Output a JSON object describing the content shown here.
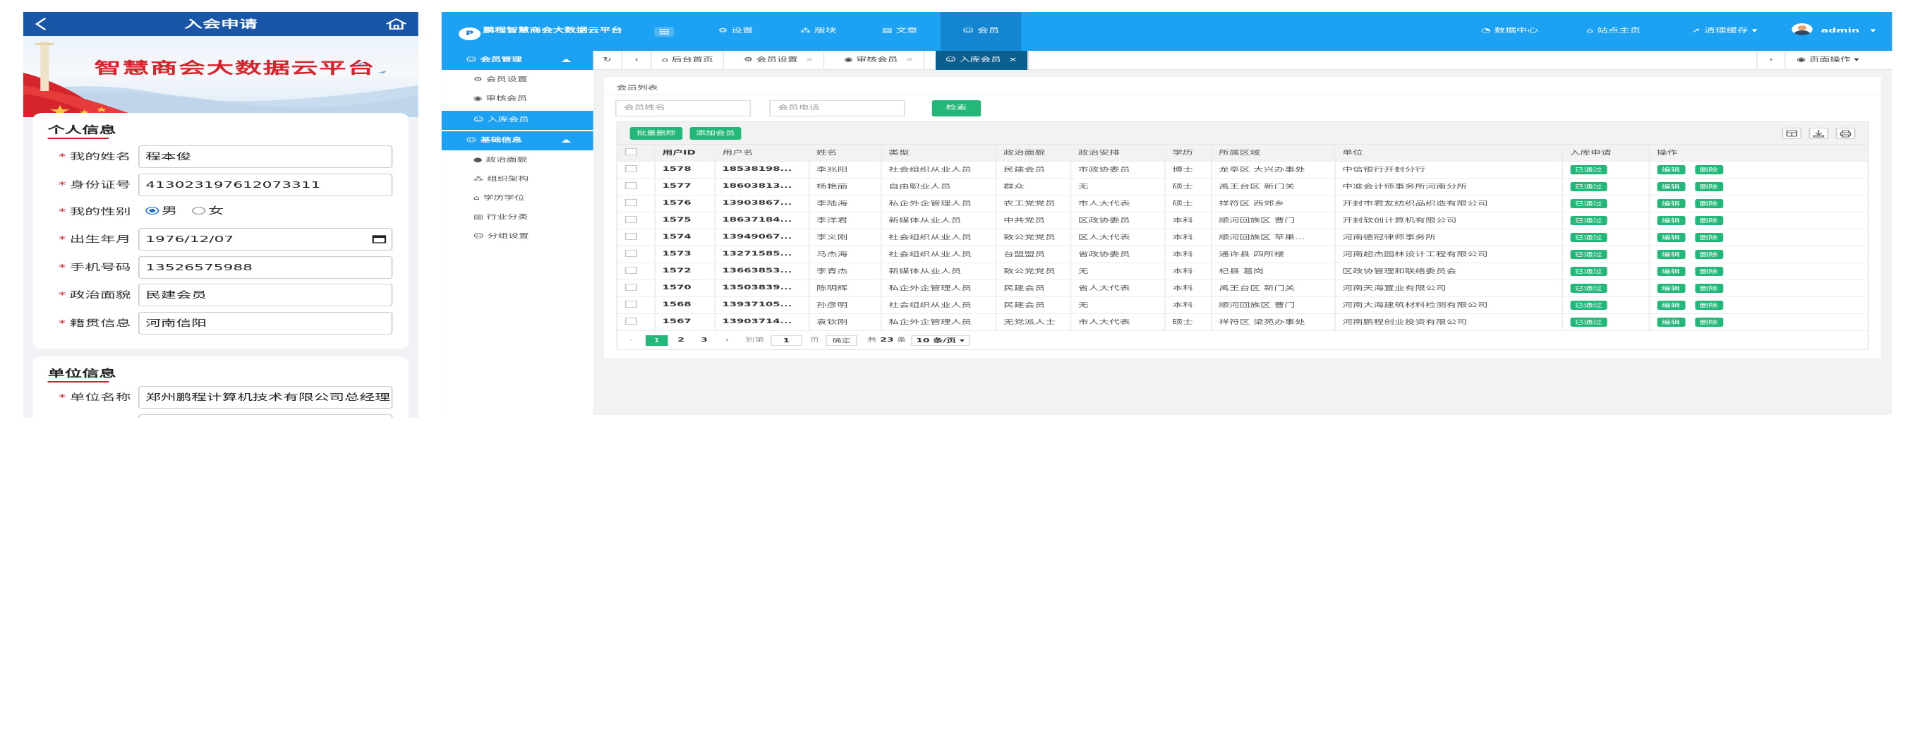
{
  "mobile": {
    "title": "入会申请",
    "banner_text": "智慧商会大数据云平台",
    "personal": {
      "section_title": "个人信息",
      "fields": [
        {
          "label": "我的姓名",
          "value": "程本俊"
        },
        {
          "label": "身份证号",
          "value": "413023197612073311"
        },
        {
          "label": "我的性别",
          "options": [
            "男",
            "女"
          ],
          "selected": "男"
        },
        {
          "label": "出生年月",
          "value": "1976/12/07"
        },
        {
          "label": "手机号码",
          "value": "13526575988"
        },
        {
          "label": "政治面貌",
          "value": "民建会员"
        },
        {
          "label": "籍贯信息",
          "value": "河南信阳"
        }
      ]
    },
    "unit": {
      "section_title": "单位信息",
      "fields": [
        {
          "label": "单位名称",
          "value": "郑州鹏程计算机技术有限公司总经理"
        }
      ]
    }
  },
  "admin": {
    "brand": "鹏程智慧商会大数据云平台",
    "logo_mark": "P",
    "top_nav": [
      {
        "icon": "gear-icon",
        "label": "设置"
      },
      {
        "icon": "blocks-icon",
        "label": "版块"
      },
      {
        "icon": "article-icon",
        "label": "文章"
      },
      {
        "icon": "user-icon",
        "label": "会员"
      }
    ],
    "top_right": [
      {
        "icon": "clock-icon",
        "label": "数据中心"
      },
      {
        "icon": "home-icon",
        "label": "站点主页"
      },
      {
        "icon": "send-icon",
        "label": "清理缓存"
      }
    ],
    "user": "admin",
    "sidebar": {
      "groups": [
        {
          "label": "会员管理",
          "items": [
            "会员设置",
            "审核会员",
            "入库会员"
          ]
        },
        {
          "label": "基础信息",
          "items": [
            "政治面貌",
            "组织架构",
            "学历学位",
            "行业分类",
            "分组设置"
          ]
        }
      ]
    },
    "tabs": [
      "后台首页",
      "会员设置",
      "审核会员",
      "入库会员"
    ],
    "page_ops": "页面操作",
    "panel_title": "会员列表",
    "search": {
      "name_placeholder": "会员姓名",
      "phone_placeholder": "会员电话",
      "button": "检索"
    },
    "actions": {
      "batch_delete": "批量删除",
      "add_member": "添加会员"
    },
    "table": {
      "headers": [
        "用户ID",
        "用户名",
        "姓名",
        "类型",
        "政治面貌",
        "政治安排",
        "学历",
        "所属区域",
        "单位",
        "入库申请",
        "操作"
      ],
      "rows": [
        [
          "1578",
          "18538198...",
          "李兆阳",
          "社会组织从业人员",
          "民建会员",
          "市政协委员",
          "博士",
          "龙亭区 大兴办事处",
          "中信银行开封分行"
        ],
        [
          "1577",
          "18603813...",
          "杨艳丽",
          "自由职业人员",
          "群众",
          "无",
          "硕士",
          "禹王台区 新门关",
          "中准会计师事务所河南分所"
        ],
        [
          "1576",
          "13903867...",
          "李陆海",
          "私企外企管理人员",
          "农工党党员",
          "市人大代表",
          "硕士",
          "祥符区 西郊乡",
          "开封市君友纺织品织造有限公司"
        ],
        [
          "1575",
          "18637184...",
          "李洋君",
          "新媒体从业人员",
          "中共党员",
          "区政协委员",
          "本科",
          "顺河回族区 曹门",
          "开封软创计算机有限公司"
        ],
        [
          "1574",
          "13949067...",
          "李义刚",
          "社会组织从业人员",
          "致公党党员",
          "区人大代表",
          "本科",
          "顺河回族区 苹果...",
          "河南德冠律师事务所"
        ],
        [
          "1573",
          "13271585...",
          "马杰海",
          "社会组织从业人员",
          "台盟盟员",
          "省政协委员",
          "本科",
          "通许县 四所楼",
          "河南超杰园林设计工程有限公司"
        ],
        [
          "1572",
          "13663853...",
          "李青杰",
          "新媒体从业人员",
          "致公党党员",
          "无",
          "本科",
          "杞县 葛岗",
          "区政协管理和联络委员会"
        ],
        [
          "1570",
          "13503839...",
          "陈明辉",
          "私企外企管理人员",
          "民建会员",
          "省人大代表",
          "本科",
          "禹王台区 新门关",
          "河南天海置业有限公司"
        ],
        [
          "1568",
          "13937105...",
          "孙彦明",
          "社会组织从业人员",
          "民建会员",
          "无",
          "本科",
          "顺河回族区 曹门",
          "河南大海建筑材料检测有限公司"
        ],
        [
          "1567",
          "13903714...",
          "袁钦刚",
          "私企外企管理人员",
          "无党派人士",
          "市人大代表",
          "硕士",
          "祥符区 梁苑办事处",
          "河南鹏程创业投资有限公司"
        ]
      ],
      "status_label": "已通过",
      "edit_label": "编辑",
      "delete_label": "删除"
    },
    "pager": {
      "pages": [
        "1",
        "2",
        "3"
      ],
      "goto_prefix": "到第",
      "goto_value": "1",
      "goto_suffix": "页",
      "confirm": "确定",
      "total_prefix": "共",
      "total": "23",
      "total_suffix": "条",
      "page_size": "10 条/页"
    }
  },
  "colors": {
    "mobile_bar": "#1a56a8",
    "accent_red": "#d5242c",
    "top_bar": "#1da1f2",
    "active_tab": "#0b5f8e",
    "green": "#23b87a"
  }
}
